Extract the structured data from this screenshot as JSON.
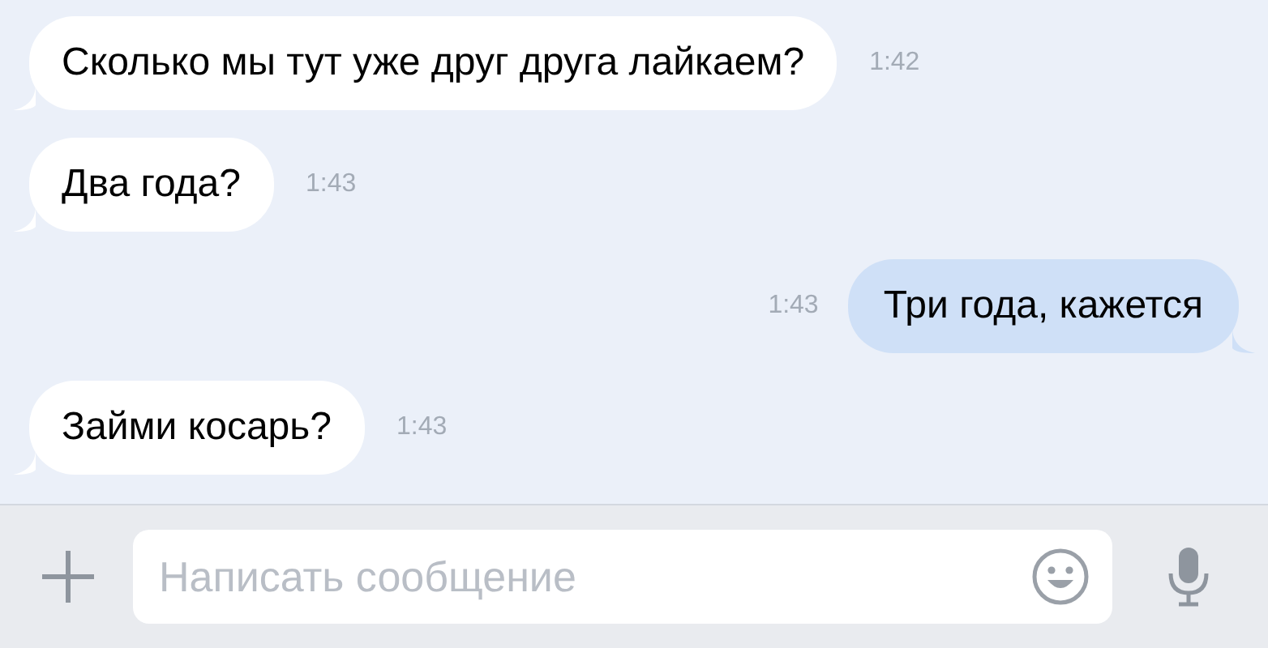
{
  "messages": [
    {
      "kind": "incoming",
      "text": "Сколько мы тут уже друг друга лайкаем?",
      "time": "1:42"
    },
    {
      "kind": "incoming",
      "text": "Два года?",
      "time": "1:43"
    },
    {
      "kind": "outgoing",
      "text": "Три года, кажется",
      "time": "1:43"
    },
    {
      "kind": "incoming",
      "text": "Займи косарь?",
      "time": "1:43"
    }
  ],
  "composer": {
    "placeholder": "Написать сообщение"
  }
}
